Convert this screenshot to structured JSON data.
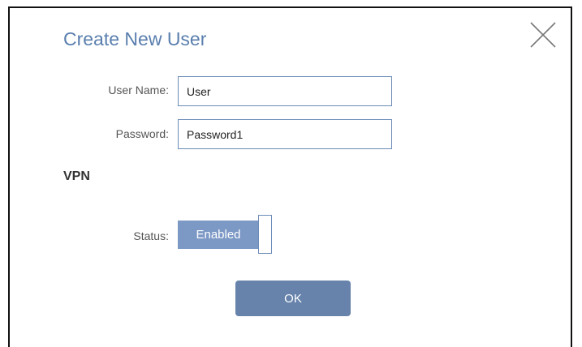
{
  "dialog": {
    "title": "Create New User"
  },
  "form": {
    "user_name_label": "User Name:",
    "user_name_value": "User",
    "password_label": "Password:",
    "password_value": "Password1"
  },
  "vpn": {
    "section_title": "VPN",
    "status_label": "Status:",
    "status_value": "Enabled"
  },
  "actions": {
    "ok_label": "OK"
  },
  "colors": {
    "accent": "#5a7fae",
    "toggle_on": "#7c98c5",
    "button": "#6783ab"
  }
}
